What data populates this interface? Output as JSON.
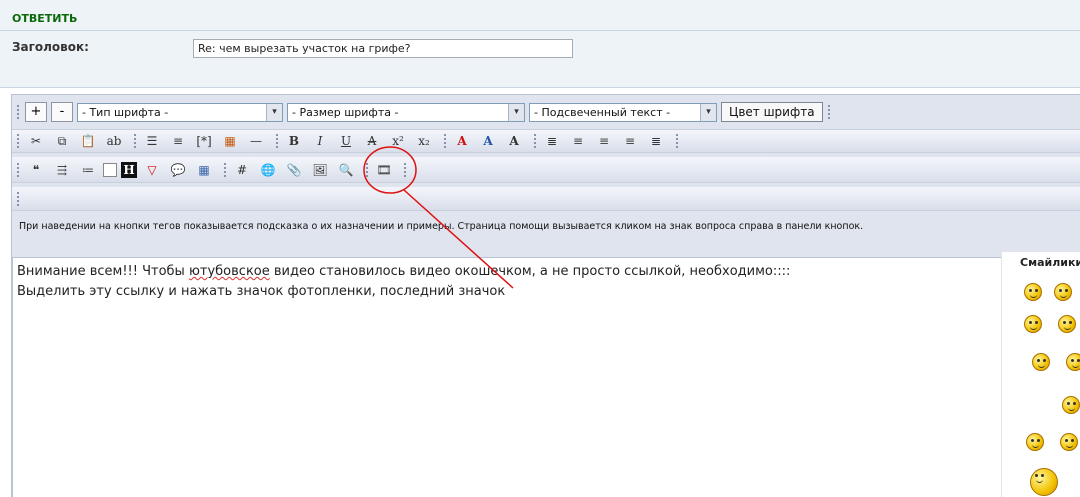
{
  "header": {
    "title": "ОТВЕТИТЬ",
    "subject_label": "Заголовок:",
    "subject_value": "Re: чем вырезать участок на грифе?"
  },
  "toolbar": {
    "plus": "+",
    "minus": "-",
    "font_type": "- Тип шрифта -",
    "font_size": "- Размер шрифта -",
    "highlight": "- Подсвеченный текст -",
    "font_color": "Цвет шрифта",
    "select_arrow": "▾",
    "format_icons": [
      {
        "name": "cut-icon",
        "glyph": "✂"
      },
      {
        "name": "copy-icon",
        "glyph": "⧉"
      },
      {
        "name": "paste-icon",
        "glyph": "📋"
      },
      {
        "name": "spellcheck-icon",
        "glyph": "ab"
      },
      {
        "name": "bullet-list-icon",
        "glyph": "☰"
      },
      {
        "name": "numbered-list-icon",
        "glyph": "≡"
      },
      {
        "name": "list-item-icon",
        "glyph": "[*]"
      },
      {
        "name": "table-icon",
        "glyph": "▦"
      },
      {
        "name": "horizontal-rule-icon",
        "glyph": "—"
      },
      {
        "name": "bold-icon",
        "glyph": "B"
      },
      {
        "name": "italic-icon",
        "glyph": "I"
      },
      {
        "name": "underline-icon",
        "glyph": "U"
      },
      {
        "name": "strikethrough-icon",
        "glyph": "A"
      },
      {
        "name": "superscript-icon",
        "glyph": "x²"
      },
      {
        "name": "subscript-icon",
        "glyph": "x₂"
      },
      {
        "name": "font-color-icon",
        "glyph": "A"
      },
      {
        "name": "text-shadow-icon",
        "glyph": "A"
      },
      {
        "name": "text-glow-icon",
        "glyph": "A"
      },
      {
        "name": "align-justify-icon",
        "glyph": "≣"
      },
      {
        "name": "align-left-icon",
        "glyph": "≡"
      },
      {
        "name": "align-center-icon",
        "glyph": "≡"
      },
      {
        "name": "align-right-icon",
        "glyph": "≡"
      },
      {
        "name": "indent-icon",
        "glyph": "≣"
      }
    ],
    "insert_icons": [
      {
        "name": "quote-icon",
        "glyph": "❝"
      },
      {
        "name": "code-icon",
        "glyph": "⇶"
      },
      {
        "name": "offtopic-icon",
        "glyph": "≔"
      },
      {
        "name": "spoiler-icon",
        "glyph": "□"
      },
      {
        "name": "heading-icon",
        "glyph": "H"
      },
      {
        "name": "warning-icon",
        "glyph": "▽"
      },
      {
        "name": "speech-icon",
        "glyph": "💬"
      },
      {
        "name": "table-insert-icon",
        "glyph": "▦"
      },
      {
        "name": "hash-link-icon",
        "glyph": "#"
      },
      {
        "name": "url-link-icon",
        "glyph": "🌐"
      },
      {
        "name": "attach-icon",
        "glyph": "📎"
      },
      {
        "name": "image-icon",
        "glyph": "🖼"
      },
      {
        "name": "search-icon",
        "glyph": "🔍"
      },
      {
        "name": "video-film-icon",
        "glyph": "🎞"
      }
    ]
  },
  "help_text": "При наведении на кнопки тегов показывается подсказка о их назначении и примеры. Страница помощи вызывается кликом на знак вопроса справа в панели кнопок.",
  "message": {
    "line1_before": "Внимание всем!!! Чтобы ",
    "line1_word": "ютубовское",
    "line1_after": " видео становилось видео окошечком, а не просто ссылкой, необходимо::::",
    "line2": "Выделить эту ссылку и нажать значок фотопленки, последний значок"
  },
  "smileys": {
    "title": "Смайлики"
  },
  "colors": {
    "accent_green": "#0a6a0a",
    "annotation_red": "#e01010",
    "toolbar_bg": "#dfe4ee"
  }
}
